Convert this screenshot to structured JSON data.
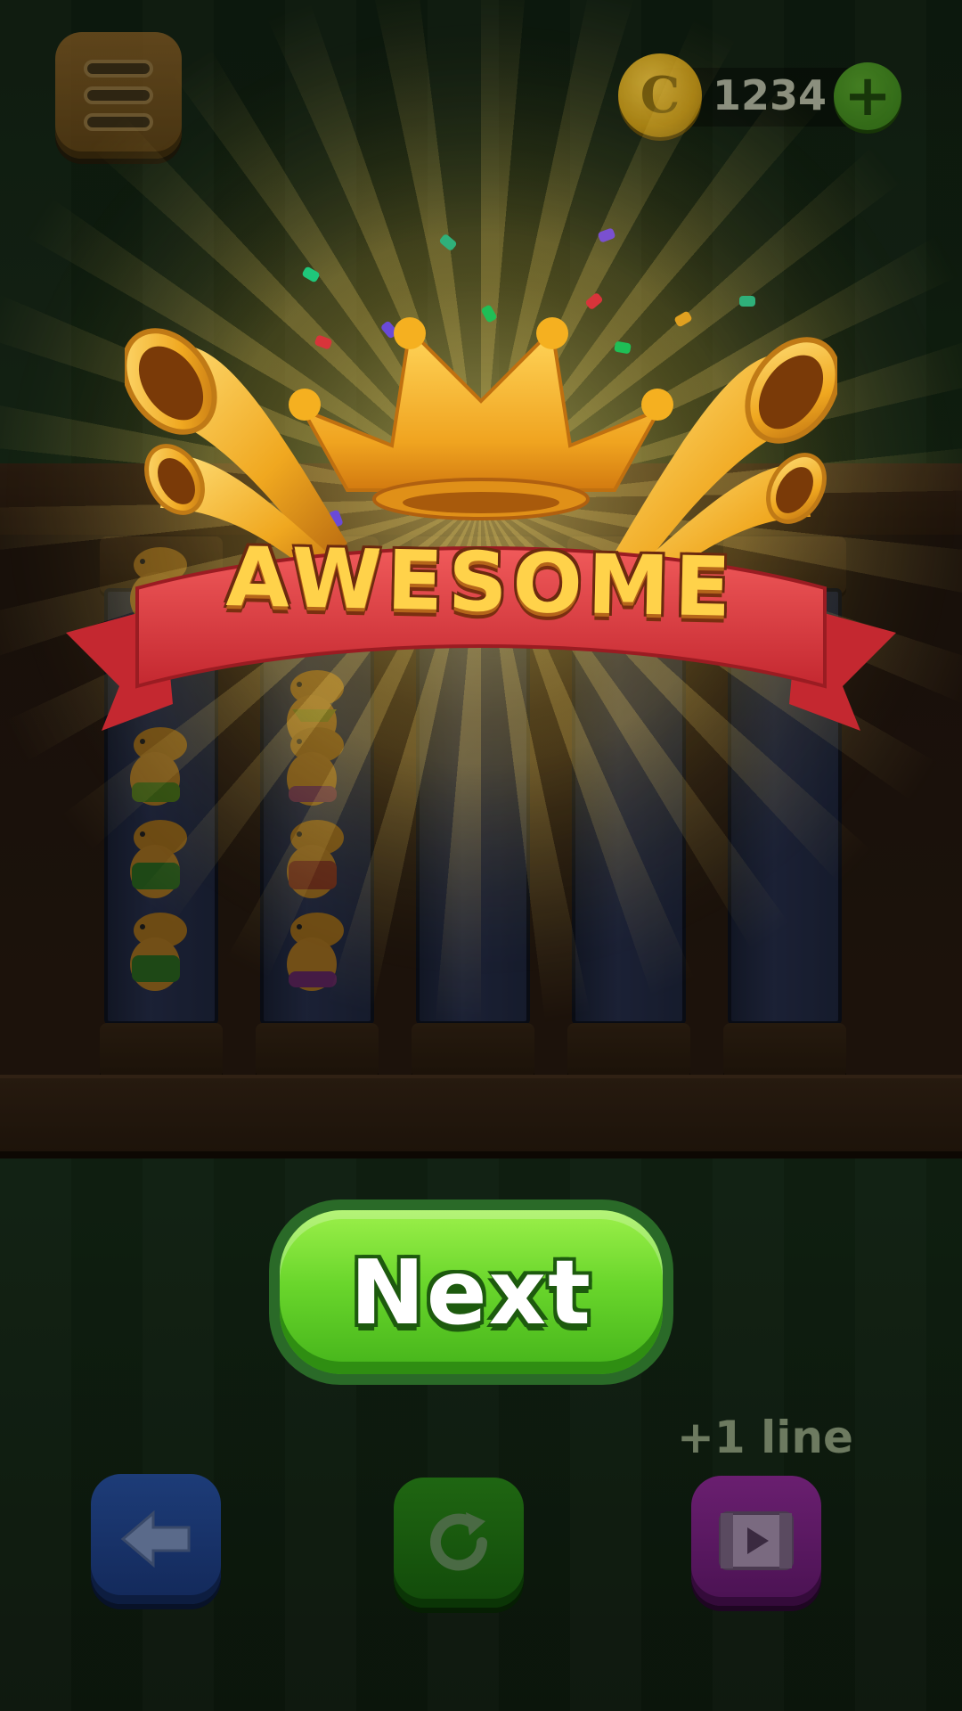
{
  "hud": {
    "coins": "1234",
    "coin_symbol": "C",
    "add_coins_symbol": "+"
  },
  "banner": {
    "title": "AWESOME"
  },
  "actions": {
    "next_label": "Next",
    "extra_line_label": "+1 line"
  },
  "icons": {
    "menu": "hamburger-icon",
    "coin": "coin-icon",
    "plus": "plus-icon",
    "back": "arrow-left-icon",
    "restart": "restart-icon",
    "video": "video-ad-icon",
    "crown": "crown-icon",
    "horn": "trumpet-icon"
  },
  "colors": {
    "next_green": "#6ad62c",
    "banner_red": "#d8343a",
    "title_gold": "#ffd24a",
    "back_blue": "#1d3c78",
    "restart_green": "#1f6612",
    "video_purple": "#6a1f70"
  }
}
